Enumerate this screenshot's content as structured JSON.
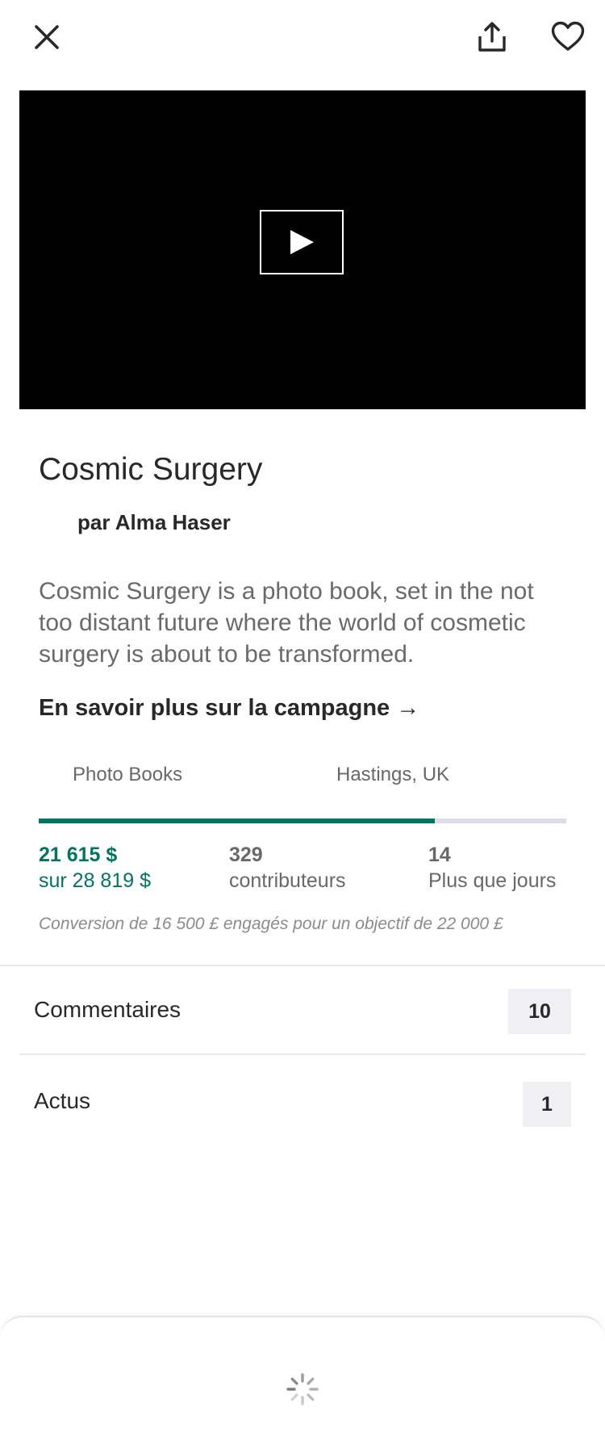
{
  "header": {
    "close_icon": "close-icon",
    "share_icon": "share-icon",
    "favorite_icon": "heart-icon"
  },
  "video": {
    "play_icon": "play-icon"
  },
  "campaign": {
    "title": "Cosmic Surgery",
    "author": "par Alma Haser",
    "blurb": "Cosmic Surgery is a photo book, set in the not too distant future where the world of cosmetic surgery is about to be transformed.",
    "learn_more": "En savoir plus sur la campagne →",
    "category": "Photo Books",
    "location": "Hastings, UK"
  },
  "funding": {
    "progress": 0.75,
    "pledged": "21 615 $",
    "goal": "sur 28 819 $",
    "backers_count": "329",
    "backers_label": "contributeurs",
    "days_count": "14",
    "days_label": "Plus que jours",
    "conversion_note": "Conversion de 16 500 £ engagés pour un objectif de 22 000 £"
  },
  "sections": {
    "comments": {
      "label": "Commentaires",
      "count": "10"
    },
    "news": {
      "label": "Actus",
      "count": "1"
    }
  },
  "bottom_sheet": {
    "loading_icon": "spinner-icon"
  },
  "colors": {
    "accent": "#037362",
    "track": "#dcdee4",
    "text_primary": "#282828",
    "text_secondary": "#656969"
  }
}
